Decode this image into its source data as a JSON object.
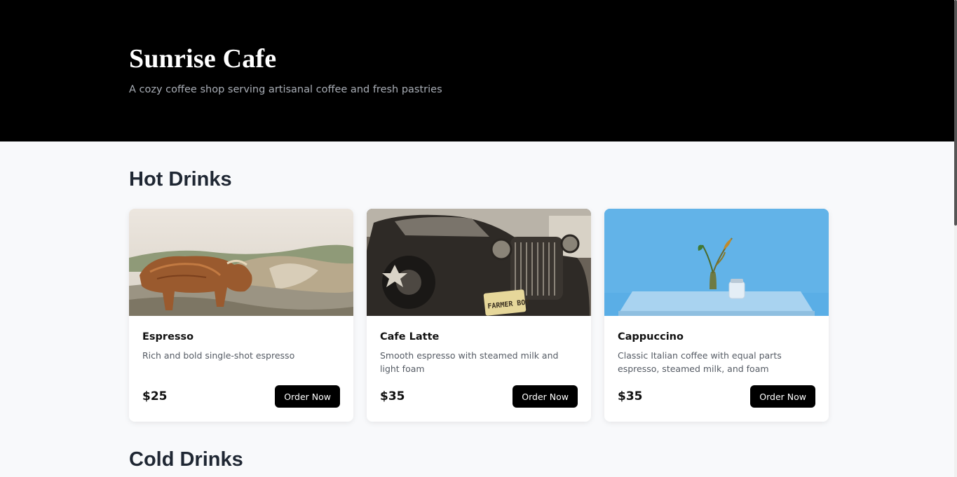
{
  "hero": {
    "title": "Sunrise Cafe",
    "subtitle": "A cozy coffee shop serving artisanal coffee and fresh pastries"
  },
  "sections": {
    "hot_title": "Hot Drinks",
    "cold_title": "Cold Drinks"
  },
  "hot_drinks": [
    {
      "name": "Espresso",
      "description": "Rich and bold single-shot espresso",
      "price": "$25",
      "button": "Order Now",
      "image": "highland-cow-photo"
    },
    {
      "name": "Cafe Latte",
      "description": "Smooth espresso with steamed milk and light foam",
      "price": "$35",
      "button": "Order Now",
      "image": "vintage-car-photo",
      "plate_text": "FARMER BOY"
    },
    {
      "name": "Cappuccino",
      "description": "Classic Italian coffee with equal parts espresso, steamed milk, and foam",
      "price": "$35",
      "button": "Order Now",
      "image": "plant-on-table-photo"
    }
  ],
  "colors": {
    "hero_bg": "#000000",
    "page_bg": "#f8f9fb",
    "button_bg": "#000000",
    "heading": "#1f2733"
  }
}
